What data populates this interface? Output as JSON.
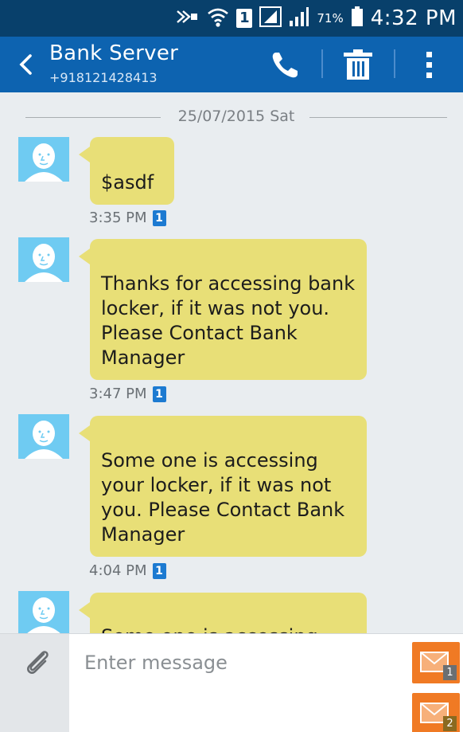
{
  "status_bar": {
    "sim": "1",
    "battery": "71%",
    "time": "4:32 PM"
  },
  "header": {
    "back_icon": "chevron-left-icon",
    "contact_name": "Bank Server",
    "contact_number": "+918121428413",
    "actions": [
      "phone-icon",
      "trash-icon",
      "more-vert-icon"
    ]
  },
  "thread": {
    "date": "25/07/2015 Sat",
    "messages": [
      {
        "text": "$asdf",
        "time": "3:35 PM",
        "sim": "1"
      },
      {
        "text": "Thanks for accessing bank locker, if it was not you. Please Contact Bank Manager",
        "time": "3:47 PM",
        "sim": "1"
      },
      {
        "text": "Some one is accessing your locker, if it was not you. Please Contact Bank Manager",
        "time": "4:04 PM",
        "sim": "1"
      },
      {
        "text": "Some one is accessing",
        "time": "",
        "sim": ""
      }
    ]
  },
  "composer": {
    "placeholder": "Enter message",
    "send_buttons": [
      {
        "icon": "envelope-icon",
        "sim": "1"
      },
      {
        "icon": "envelope-icon",
        "sim": "2"
      }
    ]
  },
  "colors": {
    "status_bar": "#08406b",
    "action_bar": "#0d63b0",
    "bubble": "#e8df77",
    "background": "#e9edf0",
    "send_button": "#f07a24"
  }
}
